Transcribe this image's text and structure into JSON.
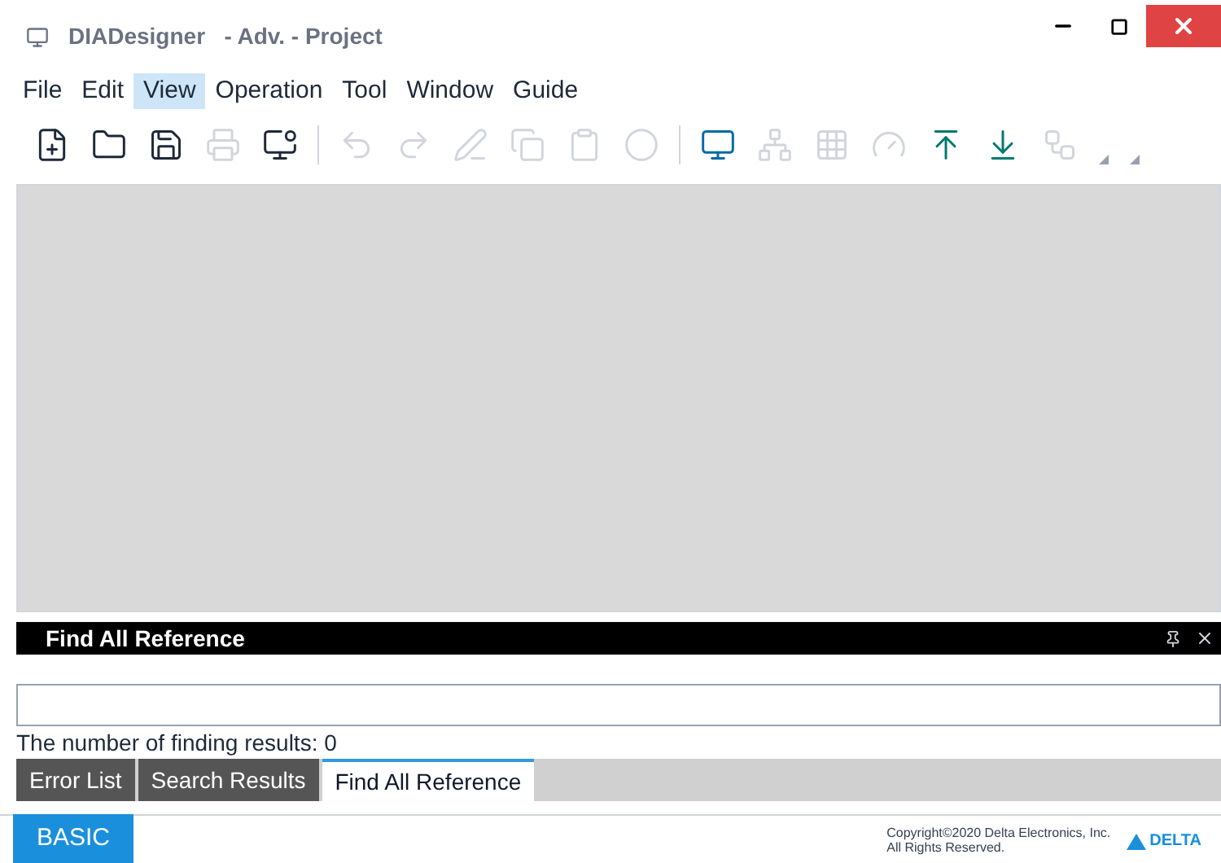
{
  "window": {
    "title": "DIADesigner   - Adv. - Project"
  },
  "menu": [
    {
      "label": "File",
      "selected": false
    },
    {
      "label": "Edit",
      "selected": false
    },
    {
      "label": "View",
      "selected": true
    },
    {
      "label": "Operation",
      "selected": false
    },
    {
      "label": "Tool",
      "selected": false
    },
    {
      "label": "Window",
      "selected": false
    },
    {
      "label": "Guide",
      "selected": false
    }
  ],
  "toolbar": [
    {
      "kind": "new",
      "disabled": false
    },
    {
      "kind": "open",
      "disabled": false
    },
    {
      "kind": "save",
      "disabled": false
    },
    {
      "kind": "print",
      "disabled": true
    },
    {
      "kind": "monitor-user",
      "disabled": false
    },
    {
      "kind": "separator"
    },
    {
      "kind": "undo",
      "disabled": true
    },
    {
      "kind": "redo",
      "disabled": true
    },
    {
      "kind": "pen",
      "disabled": true
    },
    {
      "kind": "copy",
      "disabled": true
    },
    {
      "kind": "paste",
      "disabled": true
    },
    {
      "kind": "record",
      "disabled": true
    },
    {
      "kind": "separator"
    },
    {
      "kind": "screen",
      "disabled": false
    },
    {
      "kind": "tree",
      "disabled": true
    },
    {
      "kind": "grid",
      "disabled": true
    },
    {
      "kind": "gauge",
      "disabled": true
    },
    {
      "kind": "upload",
      "disabled": false
    },
    {
      "kind": "download",
      "disabled": false
    },
    {
      "kind": "network",
      "disabled": true
    },
    {
      "kind": "corner",
      "disabled": true
    },
    {
      "kind": "corner",
      "disabled": true
    }
  ],
  "panel": {
    "title": "Find All Reference",
    "result_text": "The number of finding results: 0"
  },
  "tabs": [
    {
      "label": "Error List",
      "selected": false
    },
    {
      "label": "Search Results",
      "selected": false
    },
    {
      "label": "Find All Reference",
      "selected": true
    }
  ],
  "footer": {
    "mode_button": "BASIC",
    "copyright": [
      "Copyright©2020 Delta Electronics, Inc.",
      "All Rights Reserved."
    ],
    "logo_text": "DELTA"
  }
}
